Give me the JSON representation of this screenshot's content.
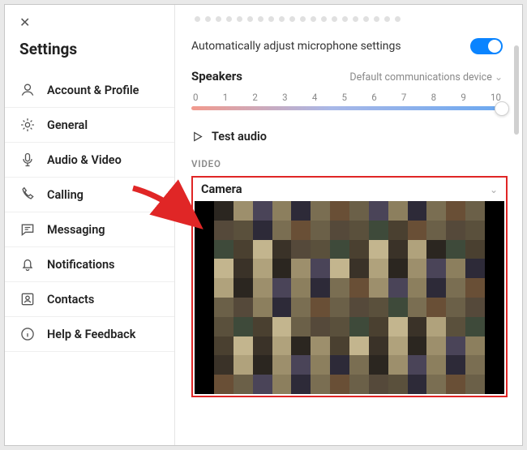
{
  "sidebar": {
    "title": "Settings",
    "items": [
      {
        "label": "Account & Profile"
      },
      {
        "label": "General"
      },
      {
        "label": "Audio & Video"
      },
      {
        "label": "Calling"
      },
      {
        "label": "Messaging"
      },
      {
        "label": "Notifications"
      },
      {
        "label": "Contacts"
      },
      {
        "label": "Help & Feedback"
      }
    ]
  },
  "content": {
    "auto_adjust_label": "Automatically adjust microphone settings",
    "speakers_label": "Speakers",
    "speakers_device": "Default communications device",
    "slider_ticks": [
      "0",
      "1",
      "2",
      "3",
      "4",
      "5",
      "6",
      "7",
      "8",
      "9",
      "10"
    ],
    "test_audio_label": "Test audio",
    "video_header": "VIDEO",
    "camera_label": "Camera"
  }
}
